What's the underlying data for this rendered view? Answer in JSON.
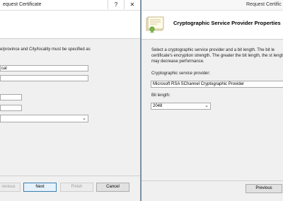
{
  "left_window": {
    "title": "equest Certificate",
    "title_help": "?",
    "title_close": "✕",
    "instruction": "e/province and City/locality must be specified as",
    "field1_value": "cal",
    "buttons": {
      "previous": "revious",
      "next": "Next",
      "finish": "Finish",
      "cancel": "Cancel"
    }
  },
  "right_window": {
    "title": "Request Certific",
    "header_title": "Cryptographic Service Provider Properties",
    "description": "Select a cryptographic service provider and a bit length. The bit le certificate's encryption strength. The greater the bit length, the st length may decrease performance.",
    "csp_label": "Cryptographic service provider:",
    "csp_value": "Microsoft RSA SChannel Cryptographic Provider",
    "bitlength_label": "Bit length:",
    "bitlength_value": "2048",
    "previous_button": "Previous"
  },
  "colors": {
    "desktop": "#1c5a8a",
    "window_bg": "#f0f0f0",
    "accent_border": "#3a8fd3"
  }
}
